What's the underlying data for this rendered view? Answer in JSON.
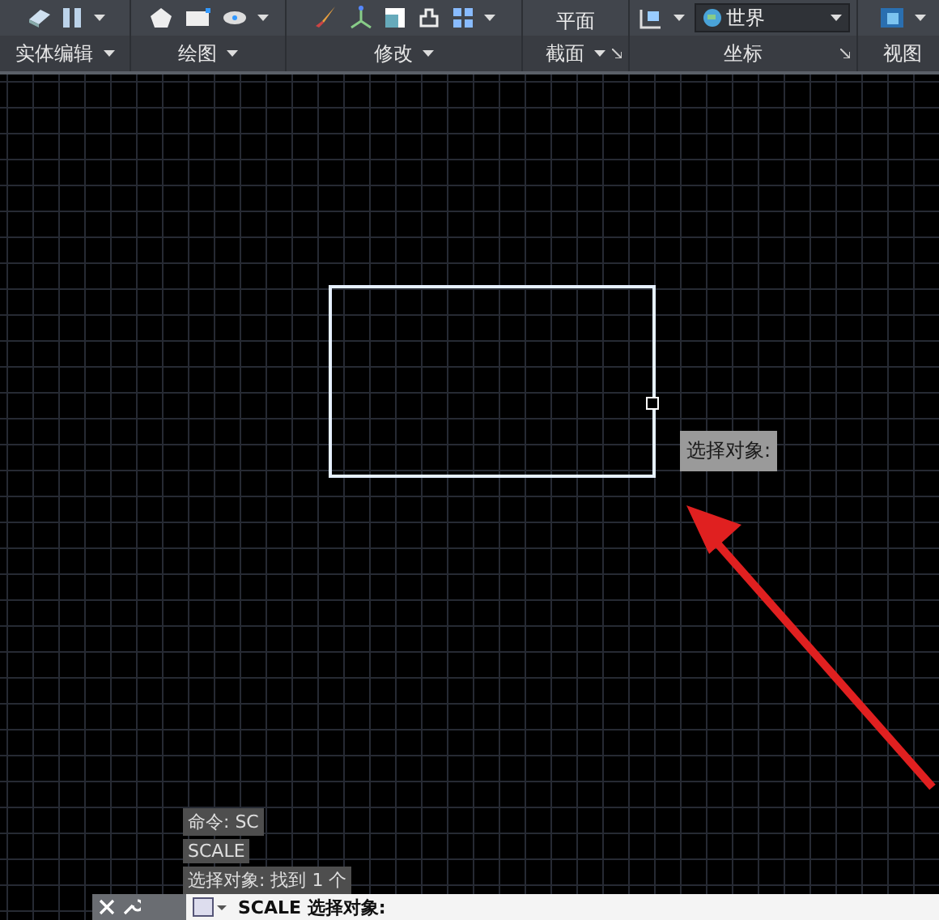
{
  "ribbon": {
    "panels": [
      {
        "kind": "solid",
        "label": "实体编辑",
        "dropdown": true,
        "launcher": false
      },
      {
        "kind": "draw",
        "label": "绘图",
        "dropdown": true,
        "launcher": false
      },
      {
        "kind": "modify",
        "label": "修改",
        "dropdown": true,
        "launcher": false
      },
      {
        "kind": "section",
        "label": "截面",
        "dropdown": true,
        "launcher": true,
        "button": "平面"
      },
      {
        "kind": "ucs",
        "label": "坐标",
        "dropdown": false,
        "launcher": true,
        "ucs_value": "世界"
      },
      {
        "kind": "view",
        "label": "视图",
        "dropdown": false,
        "launcher": false
      }
    ]
  },
  "canvas": {
    "tooltip": "选择对象:",
    "history": [
      "命令: SC",
      "SCALE",
      "选择对象: 找到 1 个"
    ]
  },
  "command_line": {
    "value": "SCALE 选择对象:"
  }
}
